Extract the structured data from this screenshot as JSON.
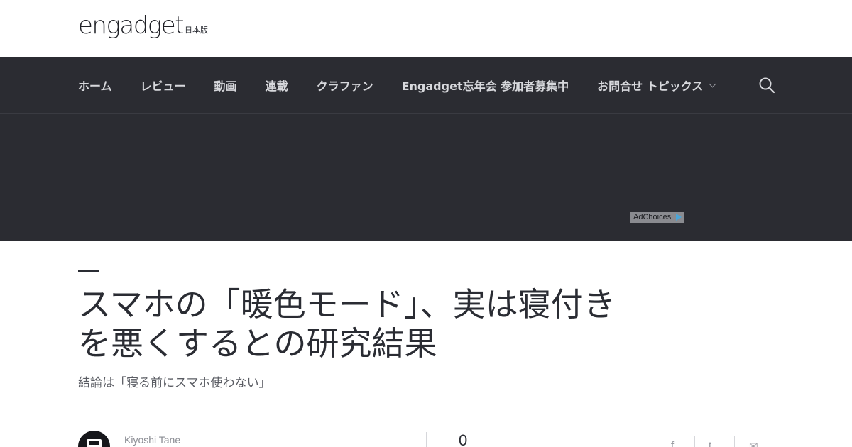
{
  "header": {
    "logo_text": "engadget",
    "logo_sub": "日本版"
  },
  "nav": {
    "items": [
      {
        "label": "ホーム"
      },
      {
        "label": "レビュー"
      },
      {
        "label": "動画"
      },
      {
        "label": "連載"
      },
      {
        "label": "クラファン"
      },
      {
        "label": "Engadget忘年会 参加者募集中"
      },
      {
        "label": "お問合せ トピックス"
      }
    ],
    "search_icon": "search-icon"
  },
  "ad": {
    "adchoices_label": "AdChoices"
  },
  "article": {
    "title": "スマホの「暖色モード」、実は寝付きを悪くするとの研究結果",
    "subtitle": "結論は「寝る前にスマホ使わない」",
    "author": "Kiyoshi Tane",
    "comment_count": "0"
  },
  "share": {
    "facebook_glyph": "f",
    "twitter_glyph": "t",
    "email_glyph": "✉"
  },
  "colors": {
    "nav_bg": "#2b2c32",
    "text_dark": "#2a2c33"
  }
}
